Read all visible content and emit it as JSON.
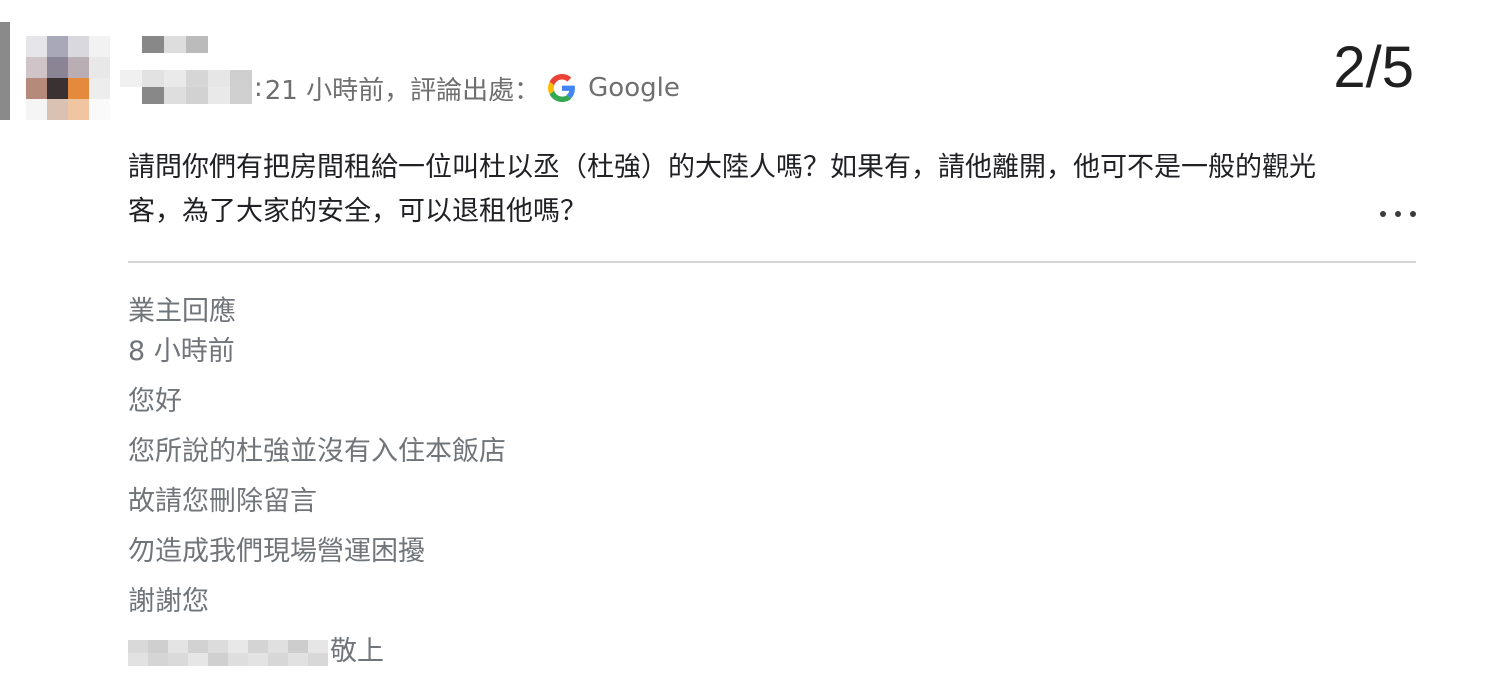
{
  "review": {
    "time_ago": "21 小時前",
    "source_label": "評論出處：",
    "source_name": "Google",
    "counter": "2/5",
    "text": "請問你們有把房間租給一位叫杜以丞（杜強）的大陸人嗎？如果有，請他離開，他可不是一般的觀光客，為了大家的安全，可以退租他嗎？",
    "more_icon": "more-horiz-icon"
  },
  "owner_reply": {
    "heading": "業主回應",
    "time_ago": "8 小時前",
    "lines": [
      "您好",
      "您所說的杜強並沒有入住本飯店",
      "故請您刪除留言",
      "勿造成我們現場營運困擾",
      "謝謝您"
    ],
    "signature_suffix": "敬上"
  },
  "colors": {
    "meta_text": "#6f6f6f",
    "review_text": "#202124",
    "reply_text": "#70757a",
    "divider": "#d6d6d6"
  }
}
